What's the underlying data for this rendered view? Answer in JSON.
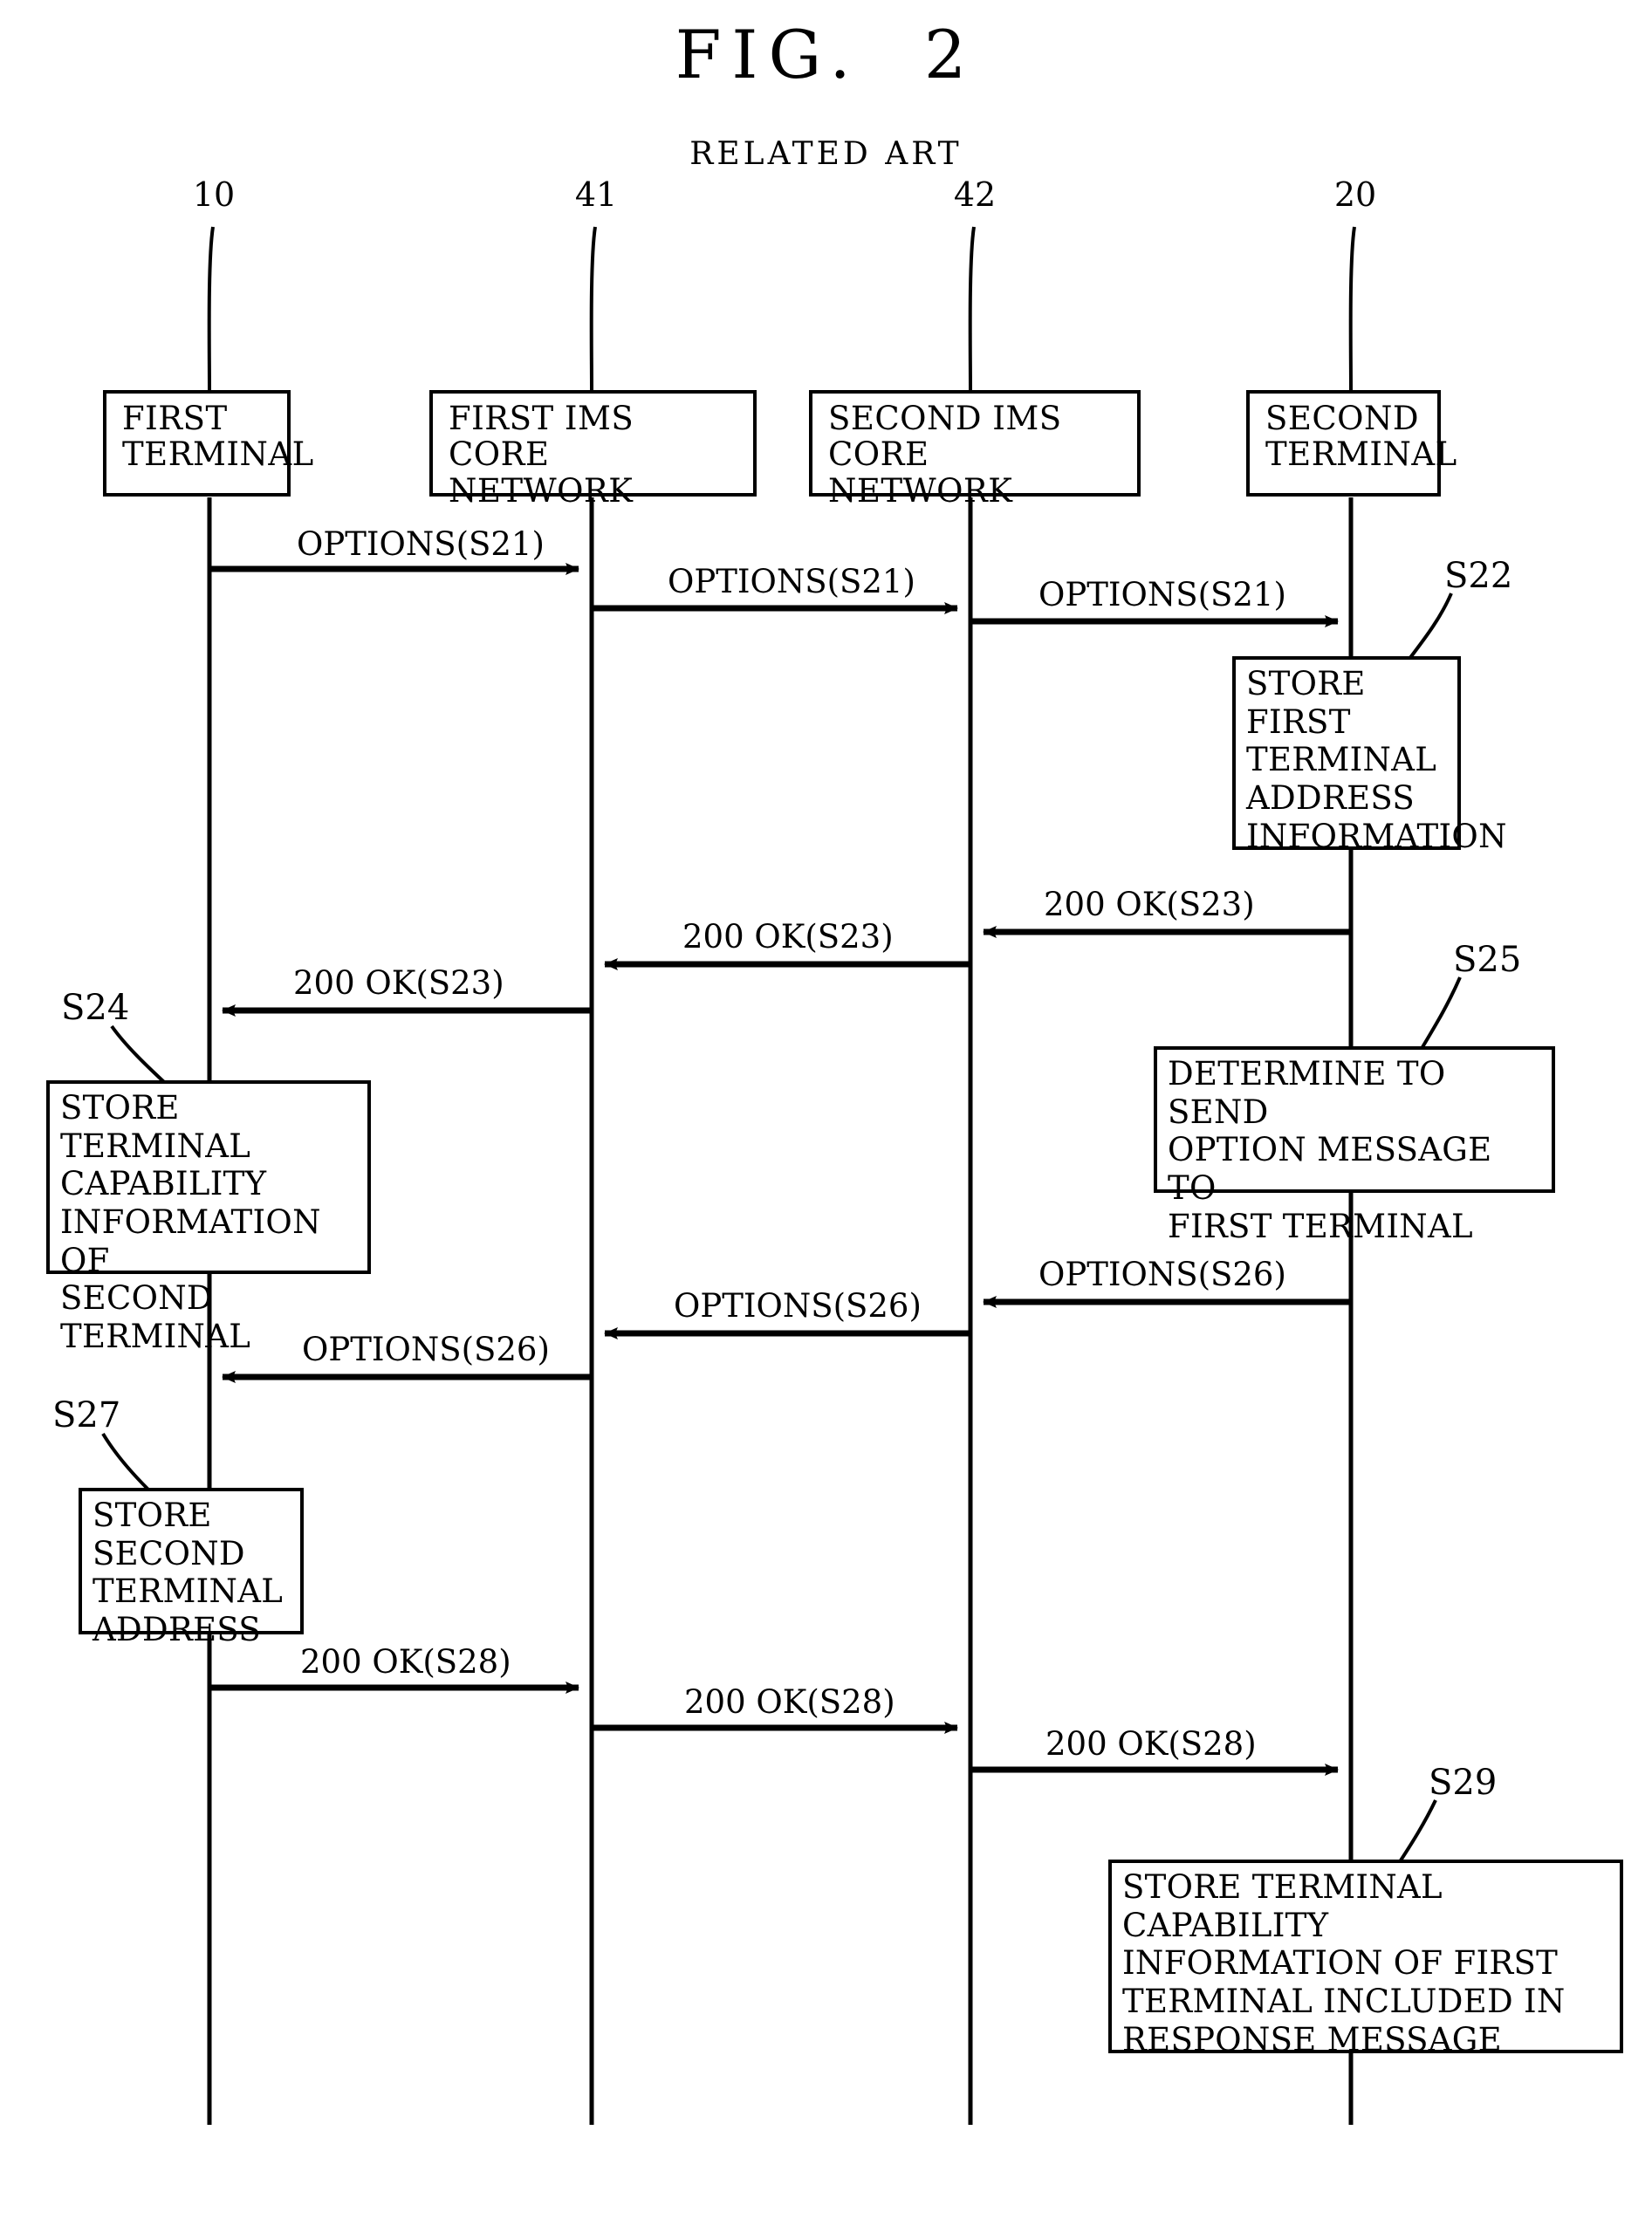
{
  "figure": {
    "title": "FIG.  2",
    "subtitle": "RELATED ART"
  },
  "lifelines": [
    {
      "ref": "10",
      "label": "FIRST\nTERMINAL"
    },
    {
      "ref": "41",
      "label": "FIRST IMS CORE\nNETWORK"
    },
    {
      "ref": "42",
      "label": "SECOND IMS CORE\nNETWORK"
    },
    {
      "ref": "20",
      "label": "SECOND\nTERMINAL"
    }
  ],
  "messages": [
    {
      "id": "m1",
      "label": "OPTIONS(S21)"
    },
    {
      "id": "m2",
      "label": "OPTIONS(S21)"
    },
    {
      "id": "m3",
      "label": "OPTIONS(S21)"
    },
    {
      "id": "m4",
      "label": "200 OK(S23)"
    },
    {
      "id": "m5",
      "label": "200 OK(S23)"
    },
    {
      "id": "m6",
      "label": "200 OK(S23)"
    },
    {
      "id": "m7",
      "label": "OPTIONS(S26)"
    },
    {
      "id": "m8",
      "label": "OPTIONS(S26)"
    },
    {
      "id": "m9",
      "label": "OPTIONS(S26)"
    },
    {
      "id": "m10",
      "label": "200 OK(S28)"
    },
    {
      "id": "m11",
      "label": "200 OK(S28)"
    },
    {
      "id": "m12",
      "label": "200 OK(S28)"
    }
  ],
  "steps": [
    {
      "id": "S22",
      "number": "S22",
      "text": "STORE FIRST\nTERMINAL\nADDRESS\nINFORMATION"
    },
    {
      "id": "S24",
      "number": "S24",
      "text": "STORE TERMINAL\nCAPABILITY\nINFORMATION OF\nSECOND TERMINAL"
    },
    {
      "id": "S25",
      "number": "S25",
      "text": "DETERMINE TO SEND\nOPTION MESSAGE TO\nFIRST TERMINAL"
    },
    {
      "id": "S27",
      "number": "S27",
      "text": "STORE SECOND\nTERMINAL\nADDRESS"
    },
    {
      "id": "S29",
      "number": "S29",
      "text": "STORE TERMINAL CAPABILITY\nINFORMATION OF FIRST\nTERMINAL INCLUDED IN\nRESPONSE MESSAGE"
    }
  ],
  "colors": {
    "ink": "#000000",
    "paper": "#ffffff"
  }
}
